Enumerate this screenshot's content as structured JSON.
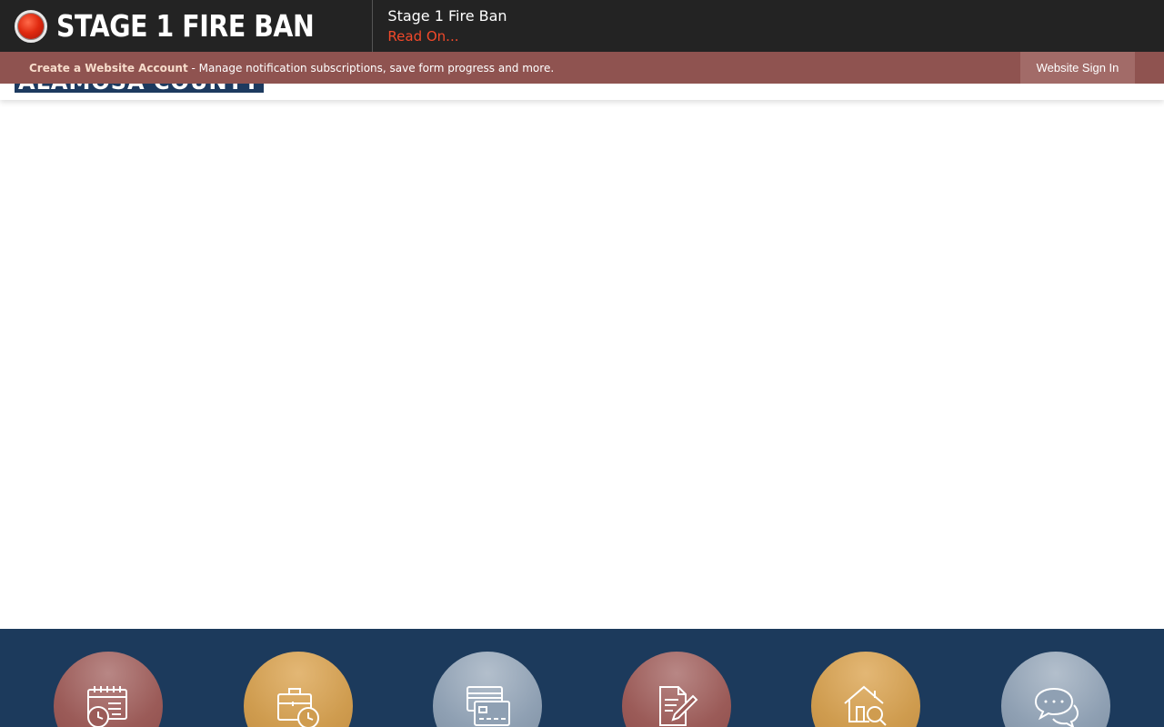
{
  "alert": {
    "banner_title": "STAGE 1 FIRE BAN",
    "headline": "Stage 1 Fire Ban",
    "link_text": "Read On..."
  },
  "account_bar": {
    "create_link": "Create a Website Account",
    "description": " - Manage notification subscriptions, save form progress and more.",
    "signin_label": "Website Sign In"
  },
  "header": {
    "logo_text": "ALAMOSA COUNTY"
  },
  "quick_links": [
    {
      "icon": "calendar-clock-icon",
      "color": "#9b5b58"
    },
    {
      "icon": "briefcase-clock-icon",
      "color": "#cf9c4f"
    },
    {
      "icon": "payment-card-icon",
      "color": "#8fa0b3"
    },
    {
      "icon": "document-pen-icon",
      "color": "#9b5b58"
    },
    {
      "icon": "house-search-icon",
      "color": "#cf9c4f"
    },
    {
      "icon": "chat-bubbles-icon",
      "color": "#8fa0b3"
    }
  ],
  "colors": {
    "alert_bg": "#232323",
    "alert_link": "#f2492a",
    "account_bar_bg": "#8f5350",
    "footer_bg": "#1c3a5c"
  }
}
